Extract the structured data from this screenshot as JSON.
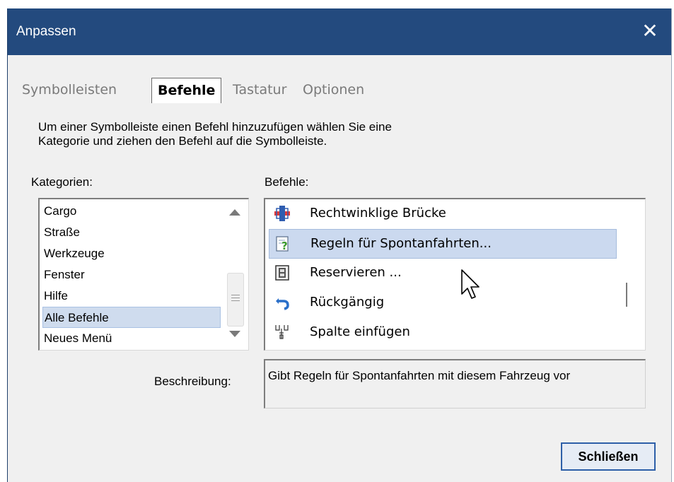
{
  "window": {
    "title": "Anpassen",
    "close_glyph": "✕"
  },
  "tabs": [
    {
      "label": "Symbolleisten",
      "active": false
    },
    {
      "label": "Befehle",
      "active": true
    },
    {
      "label": "Tastatur",
      "active": false
    },
    {
      "label": "Optionen",
      "active": false
    }
  ],
  "instructions": {
    "line1": "Um einer Symbolleiste einen Befehl hinzuzufügen wählen Sie eine",
    "line2": "Kategorie und ziehen den Befehl auf die Symbolleiste."
  },
  "categories": {
    "label": "Kategorien:",
    "items": [
      "Cargo",
      "Straße",
      "Werkzeuge",
      "Fenster",
      "Hilfe",
      "Alle Befehle",
      "Neues Menü"
    ],
    "selected": "Alle Befehle"
  },
  "commands": {
    "label": "Befehle:",
    "items": [
      {
        "label": "Rechtwinklige Brücke",
        "icon": "bridge-icon"
      },
      {
        "label": "Regeln für Spontanfahrten...",
        "icon": "rules-question-icon"
      },
      {
        "label": "Reservieren ...",
        "icon": "reserve-icon"
      },
      {
        "label": "Rückgängig",
        "icon": "undo-icon"
      },
      {
        "label": "Spalte einfügen",
        "icon": "insert-column-icon"
      }
    ],
    "selected": "Regeln für Spontanfahrten..."
  },
  "description": {
    "label": "Beschreibung:",
    "value": "Gibt Regeln für Spontanfahrten mit diesem Fahrzeug vor"
  },
  "buttons": {
    "close_label": "Schließen"
  },
  "colors": {
    "titlebar": "#234a7e",
    "selection": "#cbd9ef",
    "default_button_border": "#2d5fa8"
  }
}
